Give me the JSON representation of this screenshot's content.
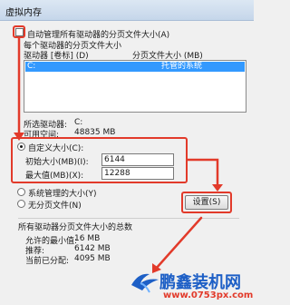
{
  "window": {
    "title": "虚拟内存"
  },
  "auto_manage": {
    "label": "自动管理所有驱动器的分页文件大小(A)",
    "checked": false
  },
  "drive_section": {
    "label": "每个驱动器的分页文件大小",
    "col_drive": "驱动器 [卷标] (D)",
    "col_size": "分页文件大小 (MB)",
    "selected_row": {
      "drive": "C:",
      "size": "托管的系统"
    }
  },
  "drive_info": {
    "drive_label": "所选驱动器:",
    "drive_value": "C:",
    "space_label": "可用空间:",
    "space_value": "48835 MB"
  },
  "custom_size": {
    "label": "自定义大小(C):",
    "selected": true,
    "initial_label": "初始大小(MB)(I):",
    "initial_value": "6144",
    "max_label": "最大值(MB)(X):",
    "max_value": "12288"
  },
  "system_managed": {
    "label": "系统管理的大小(Y)"
  },
  "no_paging": {
    "label": "无分页文件(N)"
  },
  "set_button": {
    "label": "设置(S)"
  },
  "totals": {
    "heading": "所有驱动器分页文件大小的总数",
    "min_label": "允许的最小值:",
    "min_value": "16 MB",
    "recommended_label": "推荐:",
    "recommended_value": "6142 MB",
    "current_label": "当前已分配:",
    "current_value": "4095 MB"
  },
  "watermark": {
    "brand": "鹏鑫装机网",
    "url": "www.0753px.com"
  },
  "colors": {
    "highlight": "#e23a2a",
    "selection": "#3399ff"
  }
}
